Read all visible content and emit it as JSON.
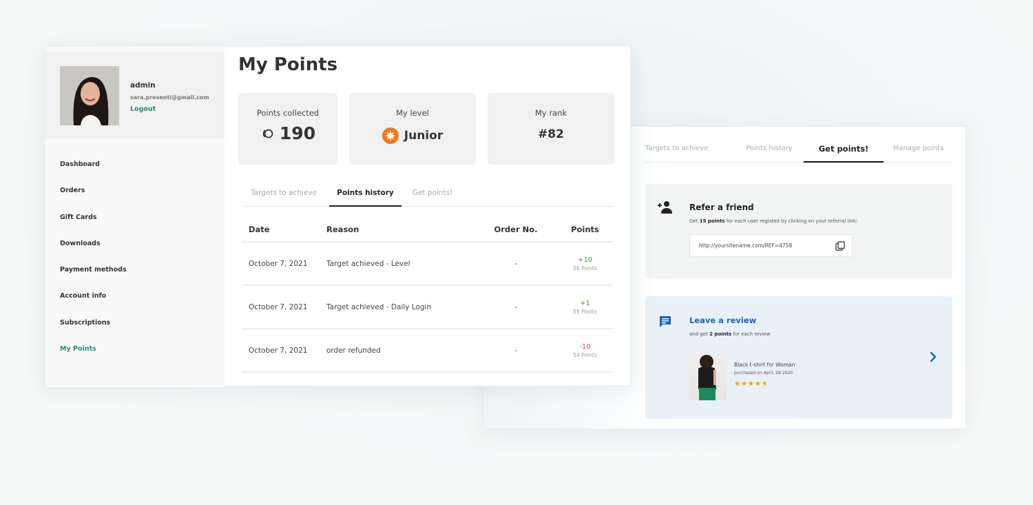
{
  "colors": {
    "accent": "#2b8a78",
    "link_blue": "#1a64b8",
    "positive": "#3a9a3a",
    "negative": "#e04545",
    "level_orange": "#f07a1a",
    "star": "#f0a500"
  },
  "profile": {
    "name": "admin",
    "email": "sara.presenti@gmail.com",
    "logout_label": "Logout"
  },
  "sidebar": {
    "items": [
      {
        "label": "Dashboard",
        "active": false
      },
      {
        "label": "Orders",
        "active": false
      },
      {
        "label": "Gift Cards",
        "active": false
      },
      {
        "label": "Downloads",
        "active": false
      },
      {
        "label": "Payment methods",
        "active": false
      },
      {
        "label": "Account info",
        "active": false
      },
      {
        "label": "Subscriptions",
        "active": false
      },
      {
        "label": "My Points",
        "active": true
      }
    ]
  },
  "main": {
    "title": "My Points",
    "stats": {
      "points_collected": {
        "label": "Points collected",
        "value": "190",
        "icon": "coins-icon"
      },
      "level": {
        "label": "My level",
        "value": "Junior",
        "icon": "starburst-badge-icon"
      },
      "rank": {
        "label": "My rank",
        "value": "#82"
      }
    },
    "tabs": [
      {
        "label": "Targets to achieve",
        "active": false
      },
      {
        "label": "Points history",
        "active": true
      },
      {
        "label": "Get points!",
        "active": false
      }
    ],
    "table": {
      "headers": [
        "Date",
        "Reason",
        "Order No.",
        "Points"
      ],
      "rows": [
        {
          "date": "October 7, 2021",
          "reason": "Target achieved - Level",
          "order": "-",
          "delta": "+10",
          "total": "56 Points",
          "sign": "pos"
        },
        {
          "date": "October 7, 2021",
          "reason": "Target achieved - Daily Login",
          "order": "-",
          "delta": "+1",
          "total": "55 Points",
          "sign": "pos"
        },
        {
          "date": "October 7, 2021",
          "reason": "order refunded",
          "order": "-",
          "delta": "-10",
          "total": "54 Points",
          "sign": "neg"
        }
      ]
    }
  },
  "get_points_panel": {
    "tabs": [
      {
        "label": "Targets to achieve",
        "active": false
      },
      {
        "label": "Points history",
        "active": false
      },
      {
        "label": "Get points!",
        "active": true
      },
      {
        "label": "Manage points",
        "active": false
      }
    ],
    "refer": {
      "title": "Refer a friend",
      "desc_prefix": "Get ",
      "desc_bold": "15 points",
      "desc_suffix": " for each user registed by clicking on your referral link:",
      "referral_url": "http://yoursitename.com/REF=4758",
      "icon": "add-person-icon",
      "copy_icon": "copy-icon"
    },
    "review": {
      "title": "Leave a review",
      "desc_prefix": "and get ",
      "desc_bold": "2 points",
      "desc_suffix": " for each review",
      "icon": "chat-message-icon",
      "product_name": "Black t-shirt for Woman",
      "purchase_date": "purchased on April, 28 2020",
      "rating": 5,
      "rating_max": 5,
      "stars_text": "★★★★★"
    }
  }
}
